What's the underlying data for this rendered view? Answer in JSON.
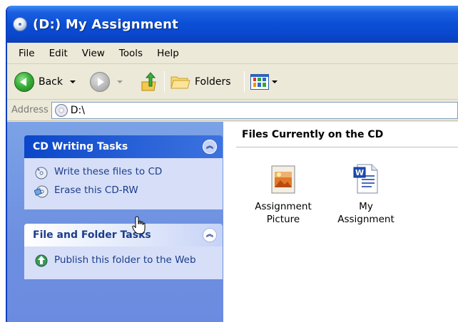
{
  "window": {
    "title": "(D:) My Assignment"
  },
  "menu": [
    "File",
    "Edit",
    "View",
    "Tools",
    "Help"
  ],
  "toolbar": {
    "back_label": "Back",
    "folders_label": "Folders"
  },
  "address": {
    "label": "Address",
    "value": "D:\\"
  },
  "tasks": {
    "cd_writing": {
      "title": "CD Writing Tasks",
      "items": [
        "Write these files to CD",
        "Erase this CD-RW"
      ]
    },
    "file_folder": {
      "title": "File and Folder Tasks",
      "items": [
        "Publish this folder to the Web"
      ]
    }
  },
  "content": {
    "title": "Files Currently on the CD",
    "files": [
      {
        "line1": "Assignment",
        "line2": "Picture",
        "icon": "picture-file-icon"
      },
      {
        "line1": "My",
        "line2": "Assignment",
        "icon": "word-document-icon"
      }
    ]
  },
  "colors": {
    "titlebar": "#0b4fd6",
    "taskpane": "#7ba2e7",
    "task_link": "#1c3c8c"
  }
}
